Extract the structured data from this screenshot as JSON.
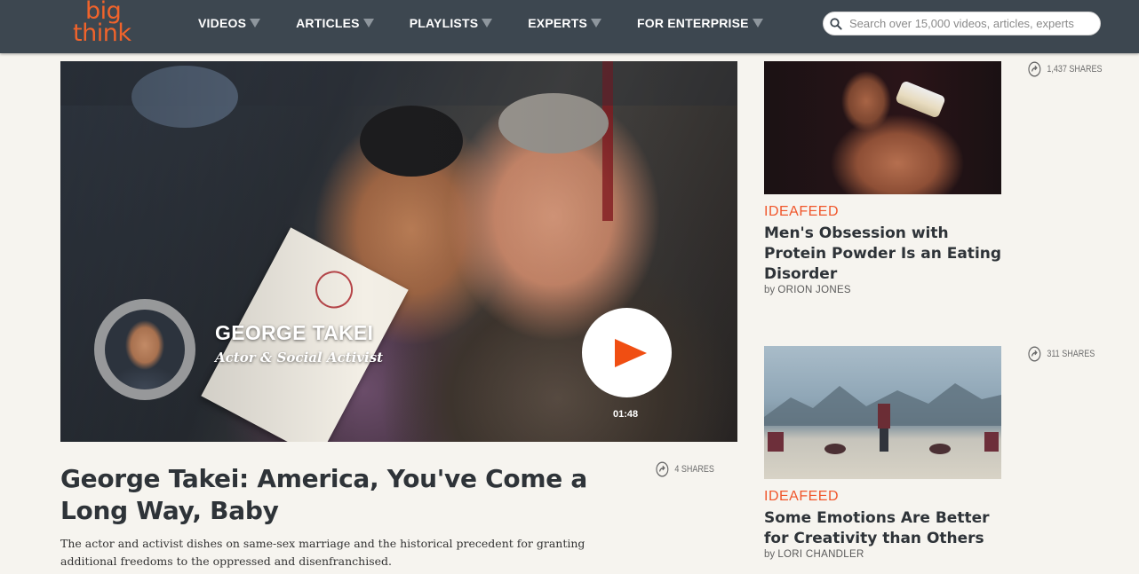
{
  "header": {
    "logo_line1": "big",
    "logo_line2": "think",
    "nav": [
      {
        "label": "VIDEOS"
      },
      {
        "label": "ARTICLES"
      },
      {
        "label": "PLAYLISTS"
      },
      {
        "label": "EXPERTS"
      },
      {
        "label": "FOR ENTERPRISE"
      }
    ],
    "search_placeholder": "Search over 15,000 videos, articles, experts"
  },
  "hero": {
    "speaker_name": "GEORGE TAKEI",
    "speaker_title": "Actor & Social Activist",
    "duration": "01:48",
    "shares": "4 SHARES",
    "title": "George Takei: America, You've Come a Long Way, Baby",
    "description": "The actor and activist dishes on same-sex marriage and the historical precedent for granting additional freedoms to the oppressed and disenfranchised."
  },
  "sidebar": {
    "cards": [
      {
        "shares": "1,437 SHARES",
        "tag": "IDEAFEED",
        "title": "Men's Obsession with Protein Powder Is an Eating Disorder",
        "by": "by",
        "author": "ORION JONES"
      },
      {
        "shares": "311 SHARES",
        "tag": "IDEAFEED",
        "title": "Some Emotions Are Better for Creativity than Others",
        "by": "by",
        "author": "LORI CHANDLER"
      }
    ]
  },
  "colors": {
    "header_bg": "#3d4750",
    "accent": "#f0562b",
    "page_bg": "#f6f4ef"
  }
}
